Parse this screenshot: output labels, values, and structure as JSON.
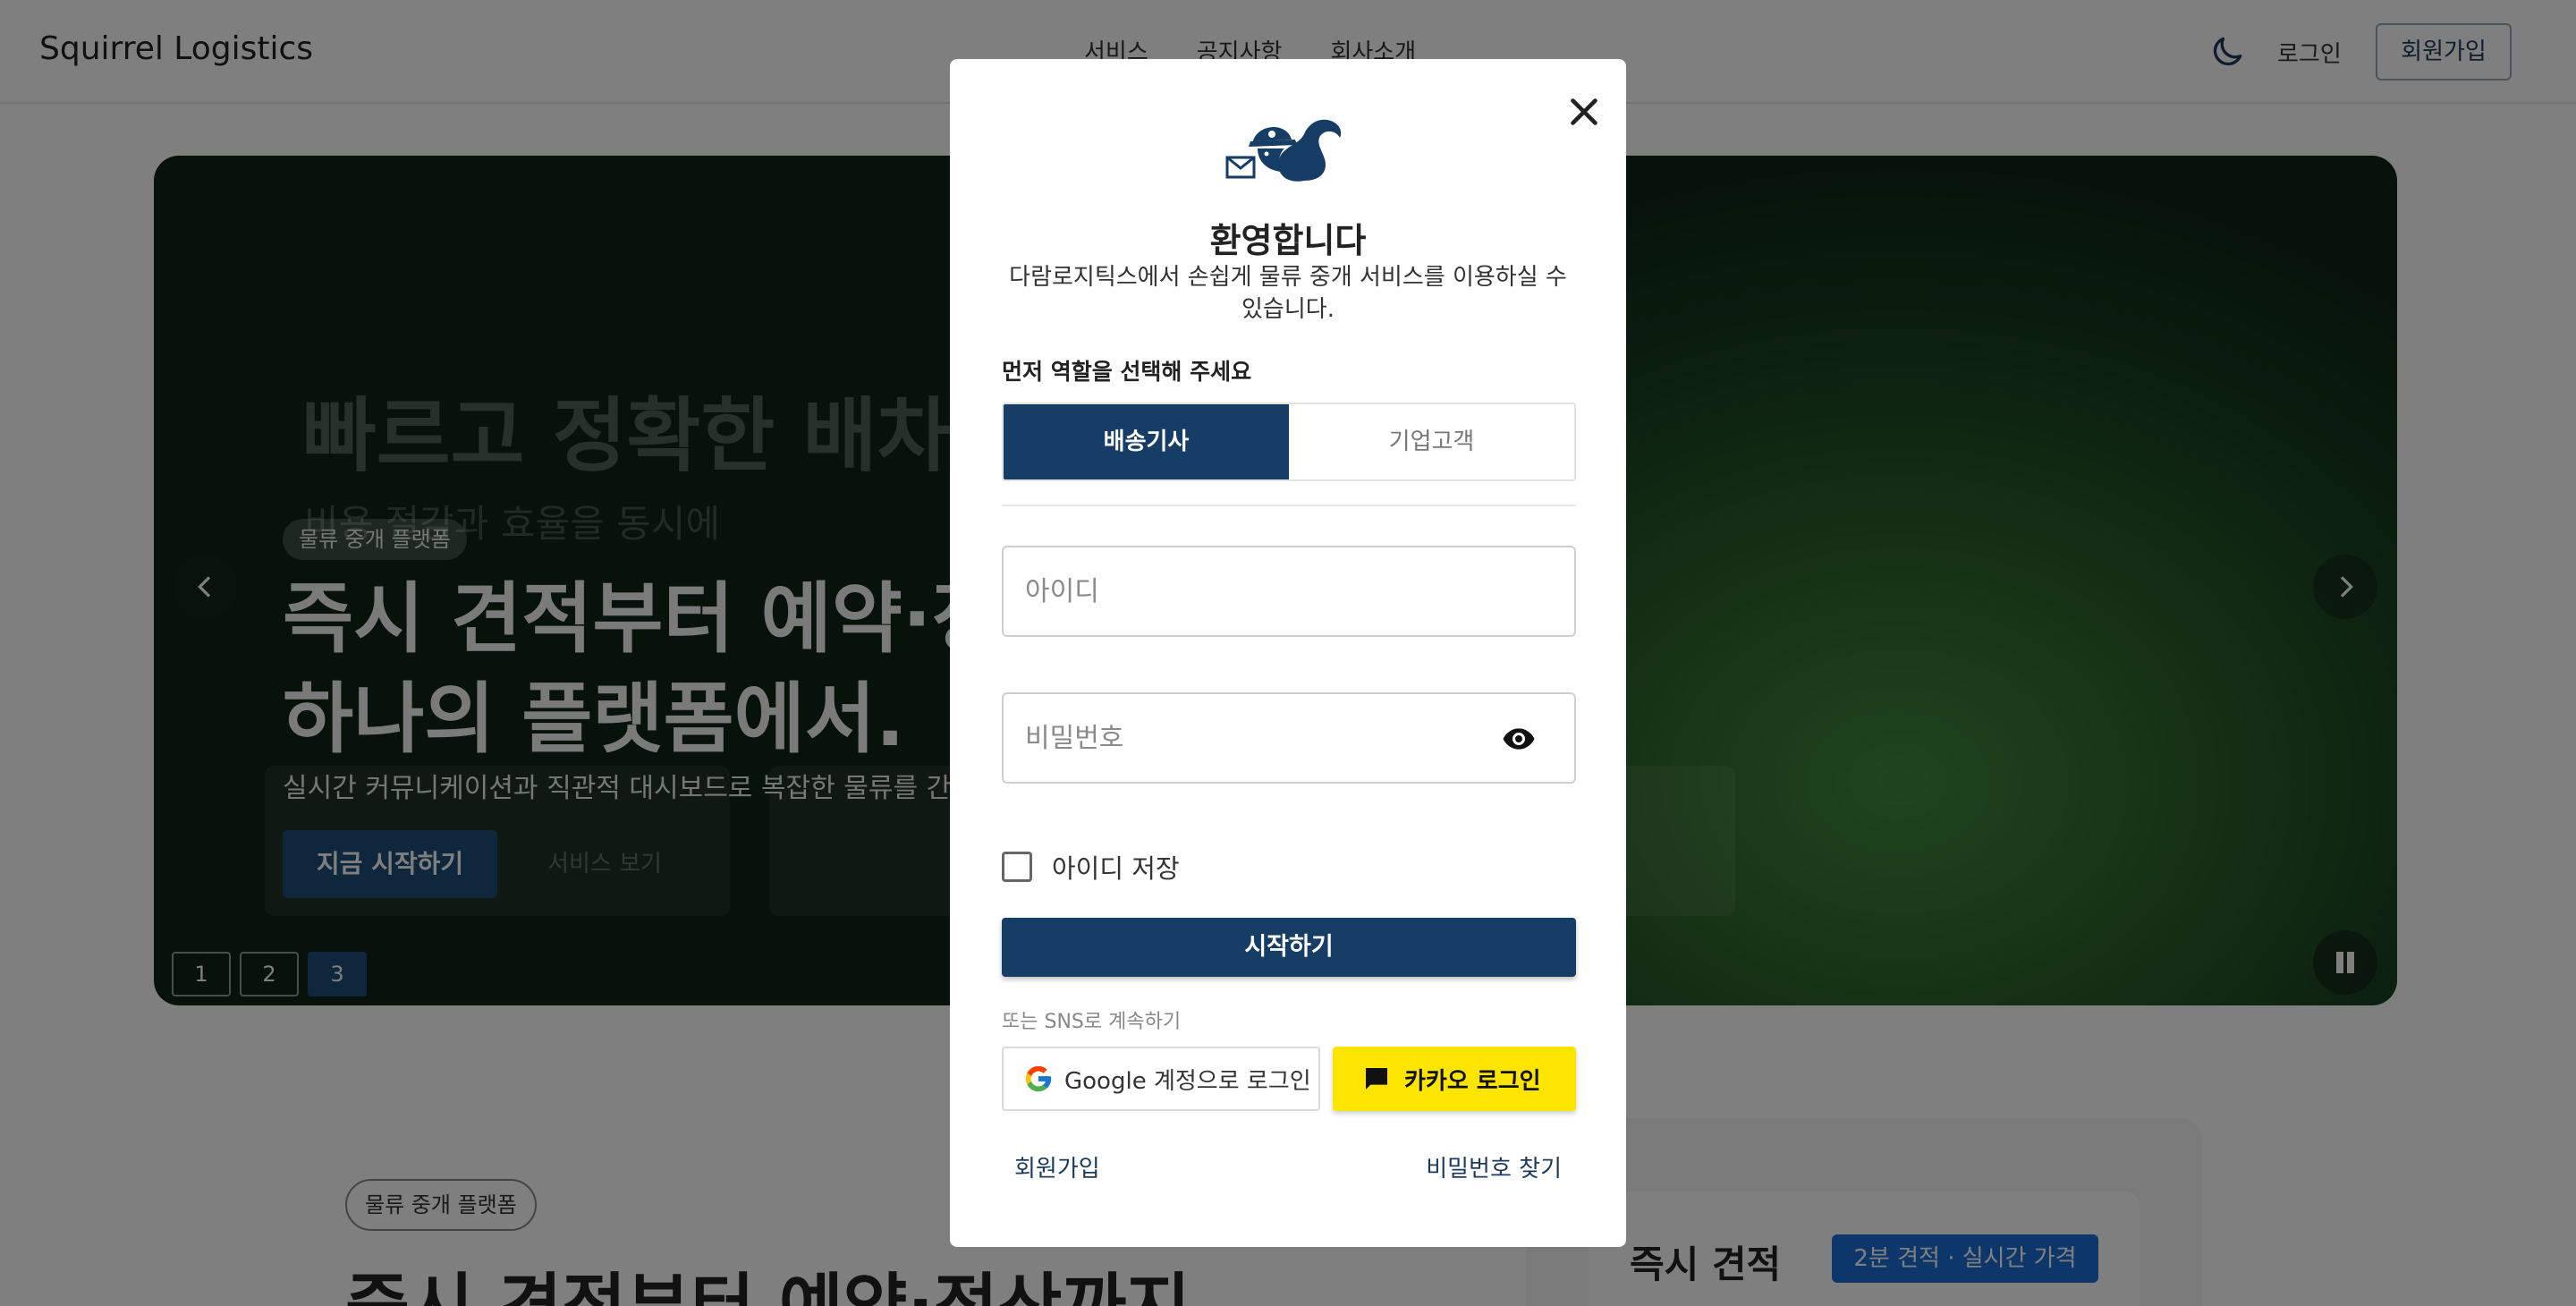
{
  "header": {
    "brand": "Squirrel Logistics",
    "nav": [
      "서비스",
      "공지사항",
      "회사소개"
    ],
    "login": "로그인",
    "signup": "회원가입"
  },
  "hero": {
    "ghost_title": "빠르고 정확한 배차",
    "ghost_subtitle": "비용 절감과 효율을 동시에",
    "badge": "물류 중개 플랫폼",
    "title_line1": "즉시 견적부터 예약·정",
    "title_line2": "하나의 플랫폼에서.",
    "description": "실시간 커뮤니케이션과 직관적 대시보드로 복잡한 물류를 간편",
    "cta": "지금 시작하기",
    "cta_secondary": "서비스 보기",
    "pages": [
      "1",
      "2",
      "3"
    ],
    "active_page": 3
  },
  "below": {
    "badge": "물류 중개 플랫폼",
    "title": "즉시 견적부터 예약·정산까지",
    "quote_title": "즉시 견적",
    "quote_badge": "2분 견적 · 실시간 가격"
  },
  "modal": {
    "welcome": "환영합니다",
    "intro": "다람로지틱스에서 손쉽게 물류 중개 서비스를 이용하실 수 있습니다.",
    "role_prompt": "먼저 역할을 선택해 주세요",
    "roles": [
      "배송기사",
      "기업고객"
    ],
    "selected_role": "배송기사",
    "id_placeholder": "아이디",
    "password_placeholder": "비밀번호",
    "remember_id": "아이디 저장",
    "start": "시작하기",
    "sns_label": "또는 SNS로 계속하기",
    "google_login": "Google 계정으로 로그인",
    "kakao_login": "카카오 로그인",
    "signup_link": "회원가입",
    "find_password_link": "비밀번호 찾기"
  },
  "colors": {
    "primary": "#163d66",
    "kakao": "#fee500",
    "quote_badge": "#1a6fd6"
  },
  "icons": {
    "close": "close-icon",
    "logo": "squirrel-mail-logo",
    "password_toggle": "eye-icon",
    "google": "google-icon",
    "kakao": "kakao-chat-icon",
    "theme": "moon-icon"
  }
}
